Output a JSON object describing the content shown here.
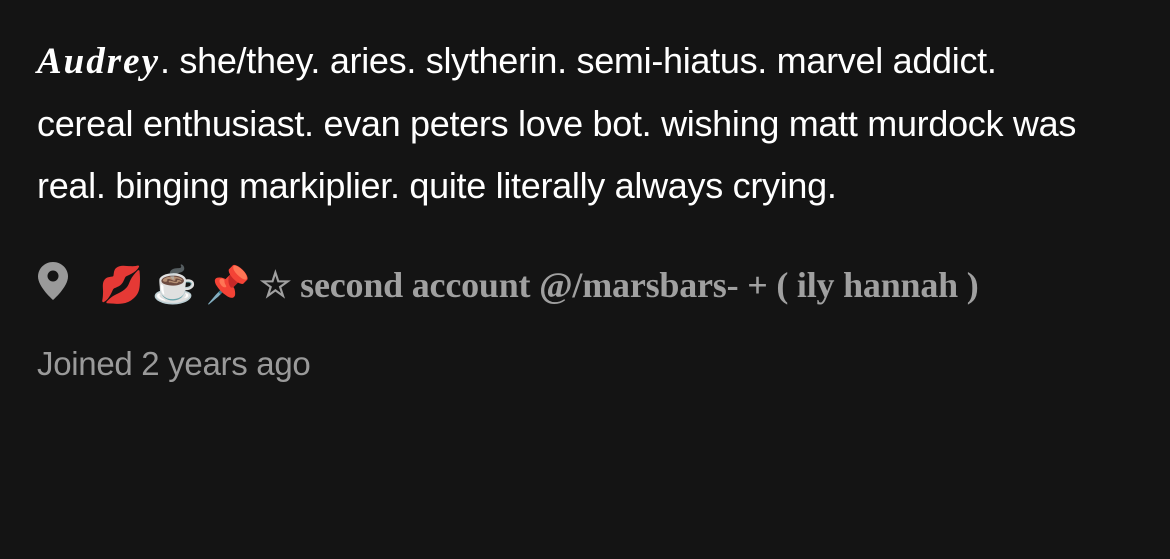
{
  "profile": {
    "name": "Audrey",
    "bio": ". she/they. aries. slytherin. semi-hiatus. marvel addict. cereal enthusiast. evan peters love bot. wishing matt murdock was real. binging markiplier. quite literally always crying.",
    "location_icon": "location-pin-icon",
    "location_text": "💋 ☕️ 📌 ☆ second account @/marsbars-   +   ( ily hannah )",
    "joined": "Joined 2 years ago"
  },
  "colors": {
    "background": "#141414",
    "bio_text": "#ffffff",
    "secondary_text": "#a0a0a0"
  }
}
